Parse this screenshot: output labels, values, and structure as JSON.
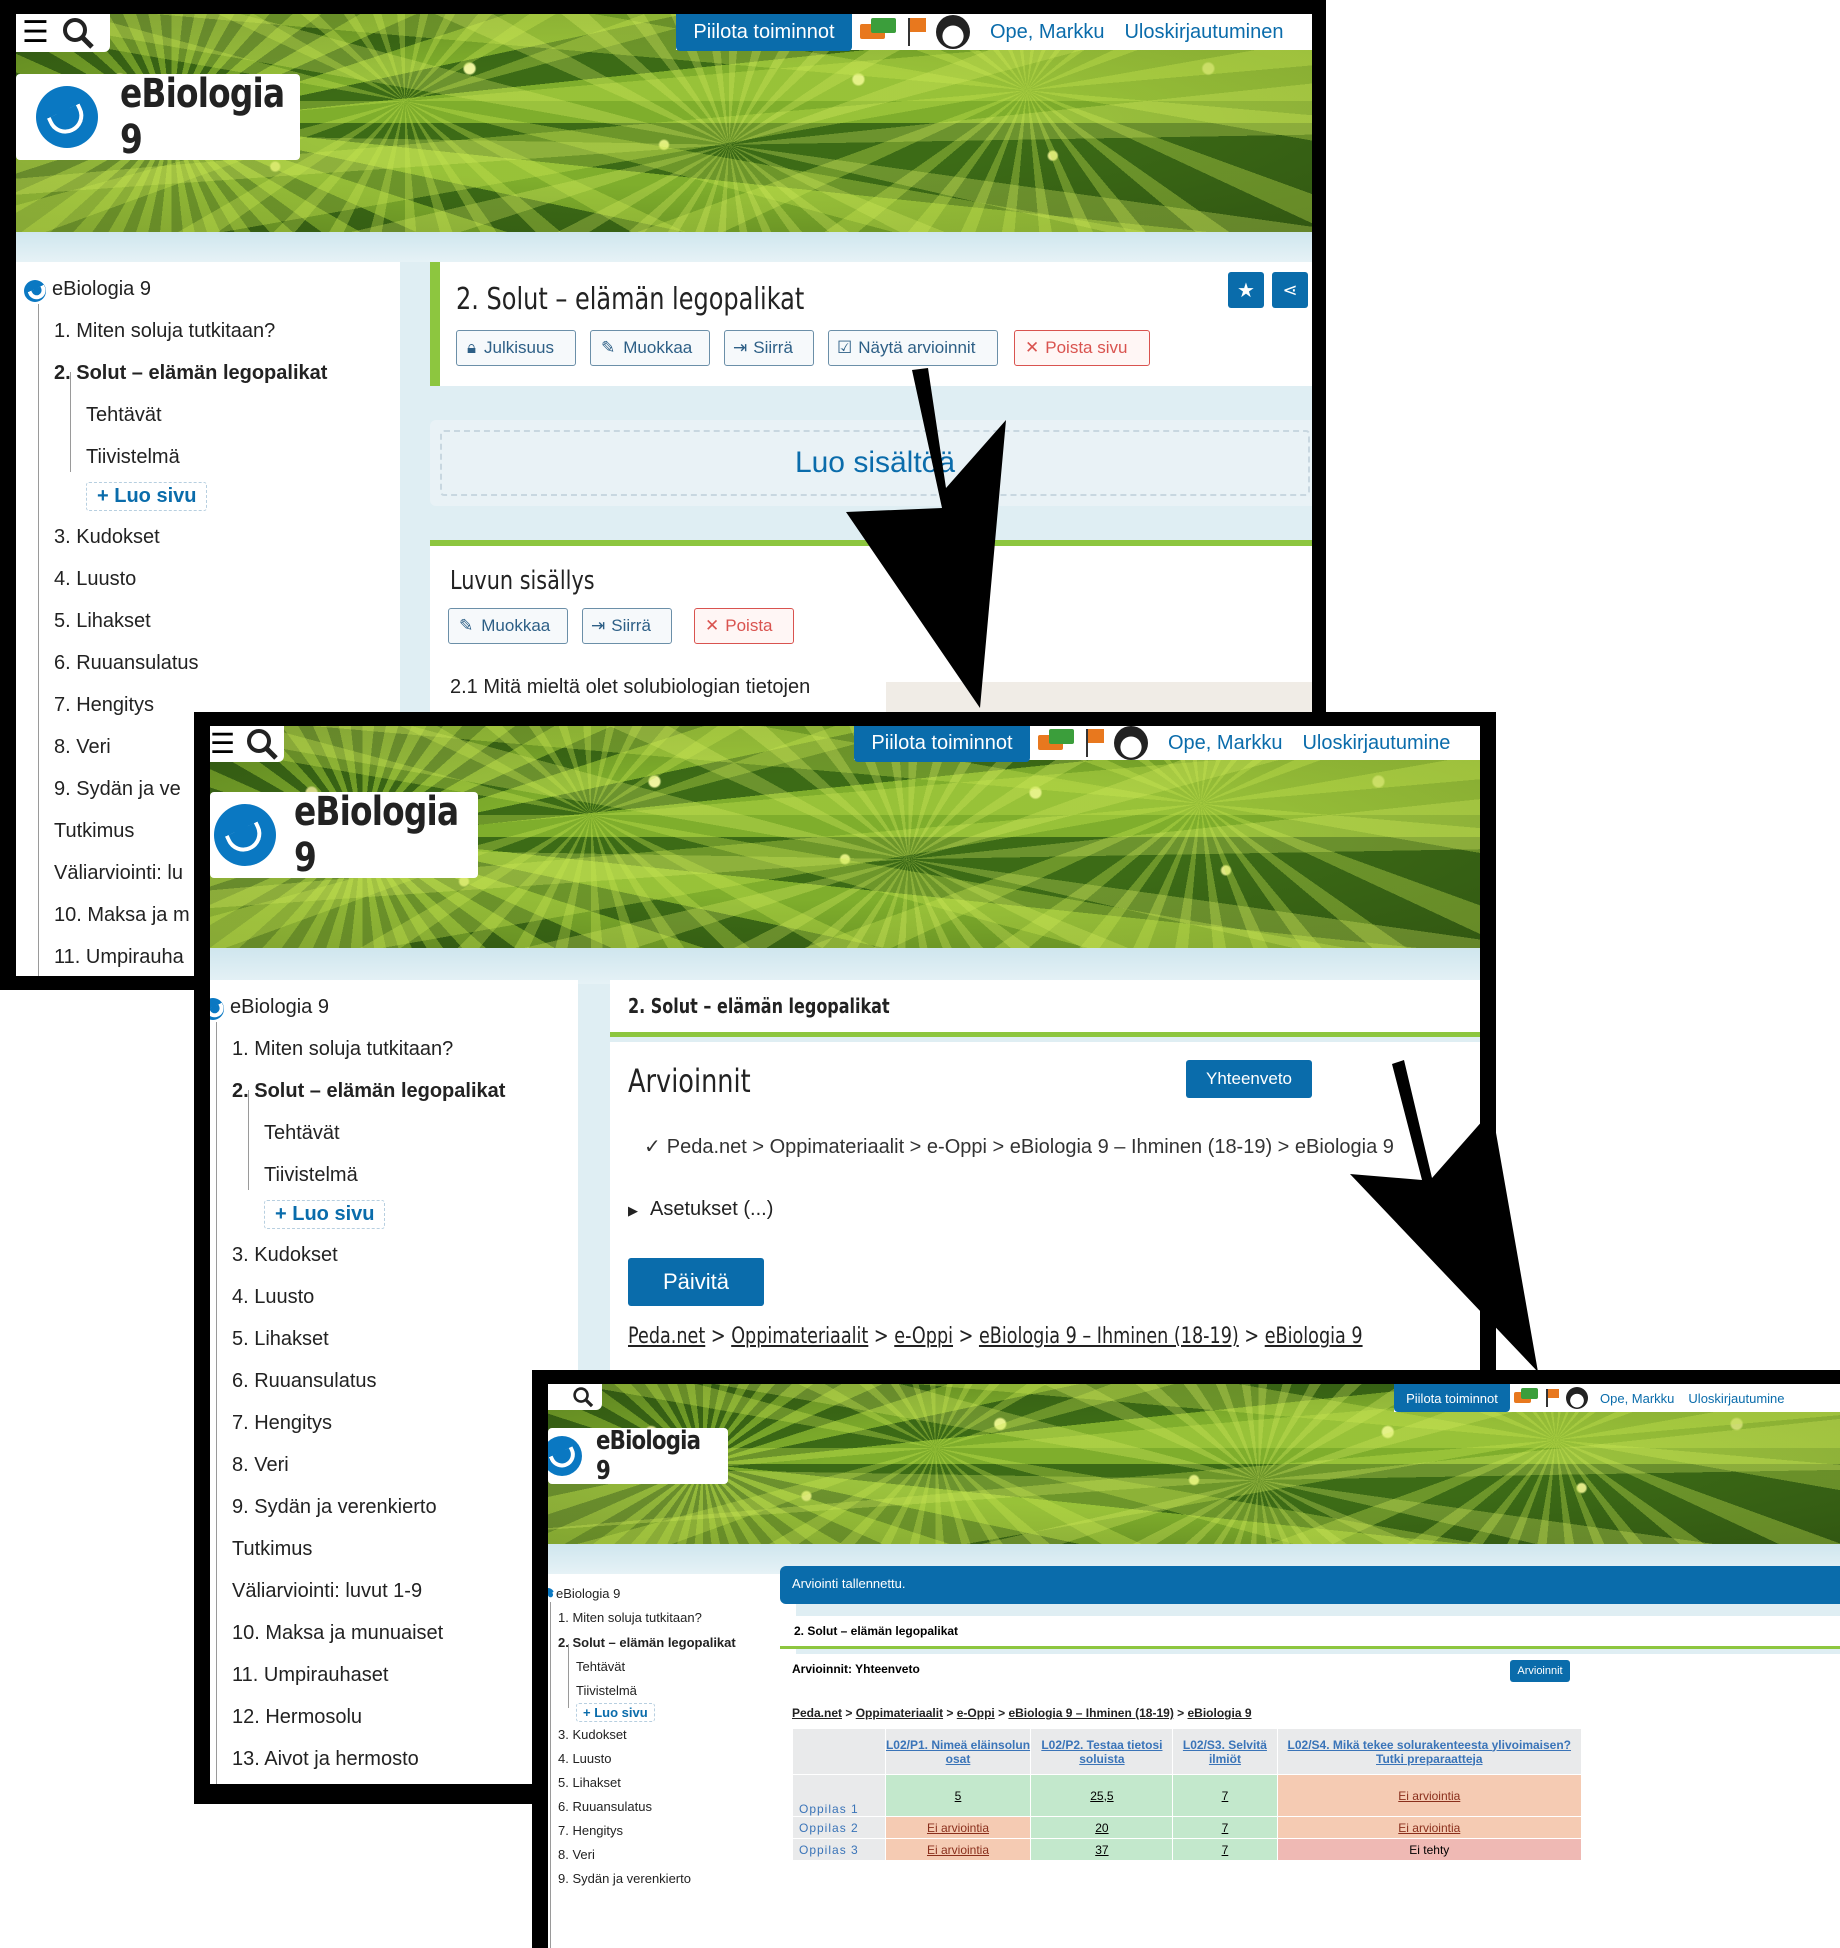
{
  "header": {
    "hide_actions": "Piilota toiminnot",
    "user": "Ope, Markku",
    "logout": "Uloskirjautuminen",
    "logout_cut": "Uloskirjautumine",
    "logo_text": "eBiologia 9"
  },
  "sidebar": {
    "root": "eBiologia 9",
    "items": [
      {
        "label": "1. Miten soluja tutkitaan?"
      },
      {
        "label": "2. Solut – elämän legopalikat"
      },
      {
        "label": "Tehtävät"
      },
      {
        "label": "Tiivistelmä"
      },
      {
        "label": "+ Luo sivu"
      },
      {
        "label": "3. Kudokset"
      },
      {
        "label": "4. Luusto"
      },
      {
        "label": "5. Lihakset"
      },
      {
        "label": "6. Ruuansulatus"
      },
      {
        "label": "7. Hengitys"
      },
      {
        "label": "8. Veri"
      },
      {
        "label": "9. Sydän ja verenkierto"
      },
      {
        "label": "Tutkimus"
      },
      {
        "label": "Väliarviointi: luvut 1-9"
      },
      {
        "label": "10. Maksa ja munuaiset"
      },
      {
        "label": "11. Umpirauhaset"
      },
      {
        "label": "12. Hermosolu"
      },
      {
        "label": "13. Aivot ja hermosto"
      }
    ],
    "cut": {
      "item9": "9. Sydän ja ve",
      "item10": "Väliarviointi: lu",
      "item11": "10. Maksa ja m",
      "item12": "11. Umpirauha"
    }
  },
  "screen1": {
    "page_title": "2. Solut – elämän legopalikat",
    "toolbar": [
      "Julkisuus",
      "Muokkaa",
      "Siirrä",
      "Näytä arvioinnit",
      "Poista sivu"
    ],
    "create_content": "Luo sisältöä",
    "section_title": "Luvun sisällys",
    "section_toolbar": [
      "Muokkaa",
      "Siirrä",
      "Poista"
    ],
    "content_text": "2.1 Mitä mieltä olet solubiologian tietojen"
  },
  "screen2": {
    "crumb_title": "2. Solut – elämän legopalikat",
    "heading": "Arvioinnit",
    "summary_button": "Yhteenveto",
    "path_check": "✓",
    "path_text": "Peda.net > Oppimateriaalit > e-Oppi > eBiologia 9 – Ihminen (18-19) > eBiologia 9",
    "settings": "Asetukset (...)",
    "update_button": "Päivitä",
    "links": [
      "Peda.net",
      "Oppimateriaalit",
      "e-Oppi",
      "eBiologia 9 – Ihminen (18-19)",
      "eBiologia 9"
    ]
  },
  "screen3": {
    "notice": "Arviointi tallennettu.",
    "crumb_title": "2. Solut – elämän legopalikat",
    "heading": "Arvioinnit: Yhteenveto",
    "back_button": "Arvioinnit",
    "links": [
      "Peda.net",
      "Oppimateriaalit",
      "e-Oppi",
      "eBiologia 9 – Ihminen (18-19)",
      "eBiologia 9"
    ],
    "columns": [
      "L02/P1. Nimeä eläinsolun osat",
      "L02/P2. Testaa tietosi soluista",
      "L02/S3. Selvitä ilmiöt",
      "L02/S4. Mikä tekee solurakenteesta ylivoimaisen? Tutki preparaatteja"
    ],
    "rows": [
      {
        "name": "Oppilas 1",
        "cells": [
          "5",
          "25,5",
          "7",
          "Ei arviointia"
        ]
      },
      {
        "name": "Oppilas 2",
        "cells": [
          "Ei arviointia",
          "20",
          "7",
          "Ei arviointia"
        ]
      },
      {
        "name": "Oppilas 3",
        "cells": [
          "Ei arviointia",
          "37",
          "7",
          "Ei tehty"
        ]
      }
    ],
    "cell_colors": {
      "done": "#c3e8cc",
      "none": "#f5cbb3",
      "missing": "#efb9b4"
    }
  }
}
